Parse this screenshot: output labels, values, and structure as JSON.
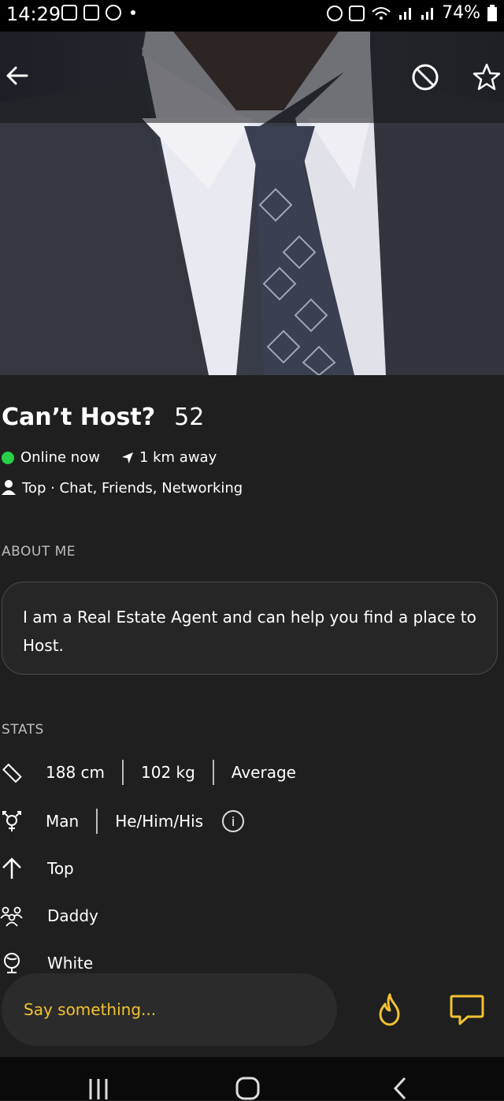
{
  "status_bar": {
    "time": "14:29",
    "battery": "74%",
    "icons": [
      "teams-icon",
      "mail-icon",
      "viber-icon",
      "notification-dot",
      "alarm-icon",
      "mute-icon",
      "wifi-icon",
      "signal-icon",
      "signal-icon",
      "battery-icon"
    ]
  },
  "profile": {
    "name": "Can’t Host?",
    "age": "52",
    "online": "Online now",
    "distance": "1 km away",
    "role_line": "Top · Chat, Friends, Networking"
  },
  "about": {
    "label": "ABOUT ME",
    "text": "I am a Real Estate Agent and can help you find a place to Host."
  },
  "stats": {
    "label": "STATS",
    "height": "188 cm",
    "weight": "102 kg",
    "body": "Average",
    "gender": "Man",
    "pronouns": "He/Him/His",
    "position": "Top",
    "tribe": "Daddy",
    "ethnicity": "White"
  },
  "compose": {
    "placeholder": "Say something..."
  },
  "colors": {
    "accent": "#f2c230",
    "online": "#27d046",
    "background": "#1f1f1f"
  }
}
